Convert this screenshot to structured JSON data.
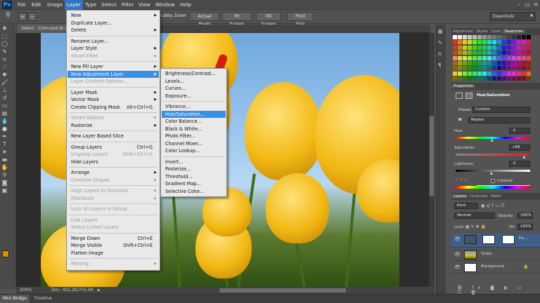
{
  "app": {
    "logo": "Ps"
  },
  "menubar": {
    "items": [
      "File",
      "Edit",
      "Image",
      "Layer",
      "Type",
      "Select",
      "Filter",
      "View",
      "Window",
      "Help"
    ],
    "active": "Layer"
  },
  "window_buttons": [
    "–",
    "▭",
    "✕"
  ],
  "options": {
    "buttons": [
      "rubby Zoom",
      "Actual Pixels",
      "Fit Screen",
      "Fill Screen",
      "Print Size"
    ],
    "workspace": "Essentials"
  },
  "document": {
    "tab": "Select - Color.psd @ 2",
    "zoom": "200%",
    "doc_info": "Doc: 452.2K/755.5K"
  },
  "bottom_tabs": [
    "Mini Bridge",
    "Timeline"
  ],
  "layer_menu": {
    "items": [
      {
        "label": "New",
        "arrow": true
      },
      {
        "label": "Duplicate Layer..."
      },
      {
        "label": "Delete",
        "arrow": true
      },
      {
        "sep": true
      },
      {
        "label": "Rename Layer..."
      },
      {
        "label": "Layer Style",
        "arrow": true
      },
      {
        "label": "Smart Filter",
        "arrow": true,
        "disabled": true
      },
      {
        "sep": true
      },
      {
        "label": "New Fill Layer",
        "arrow": true
      },
      {
        "label": "New Adjustment Layer",
        "arrow": true,
        "highlight": true
      },
      {
        "label": "Layer Content Options...",
        "disabled": true
      },
      {
        "sep": true
      },
      {
        "label": "Layer Mask",
        "arrow": true
      },
      {
        "label": "Vector Mask",
        "arrow": true
      },
      {
        "label": "Create Clipping Mask",
        "shortcut": "Alt+Ctrl+G"
      },
      {
        "sep": true
      },
      {
        "label": "Smart Objects",
        "arrow": true,
        "disabled": true
      },
      {
        "label": "Rasterize",
        "arrow": true
      },
      {
        "sep": true
      },
      {
        "label": "New Layer Based Slice"
      },
      {
        "sep": true
      },
      {
        "label": "Group Layers",
        "shortcut": "Ctrl+G"
      },
      {
        "label": "Ungroup Layers",
        "shortcut": "Shift+Ctrl+G",
        "disabled": true
      },
      {
        "label": "Hide Layers"
      },
      {
        "sep": true
      },
      {
        "label": "Arrange",
        "arrow": true
      },
      {
        "label": "Combine Shapes",
        "arrow": true,
        "disabled": true
      },
      {
        "sep": true
      },
      {
        "label": "Align Layers to Selection",
        "arrow": true,
        "disabled": true
      },
      {
        "label": "Distribute",
        "arrow": true,
        "disabled": true
      },
      {
        "sep": true
      },
      {
        "label": "Lock All Layers in Group...",
        "disabled": true
      },
      {
        "sep": true
      },
      {
        "label": "Link Layers",
        "disabled": true
      },
      {
        "label": "Select Linked Layers",
        "disabled": true
      },
      {
        "sep": true
      },
      {
        "label": "Merge Down",
        "shortcut": "Ctrl+E"
      },
      {
        "label": "Merge Visible",
        "shortcut": "Shift+Ctrl+E"
      },
      {
        "label": "Flatten Image"
      },
      {
        "sep": true
      },
      {
        "label": "Matting",
        "arrow": true,
        "disabled": true
      }
    ]
  },
  "adjustment_submenu": {
    "items": [
      {
        "label": "Brightness/Contrast..."
      },
      {
        "label": "Levels..."
      },
      {
        "label": "Curves..."
      },
      {
        "label": "Exposure..."
      },
      {
        "sep": true
      },
      {
        "label": "Vibrance..."
      },
      {
        "label": "Hue/Saturation...",
        "highlight": true
      },
      {
        "label": "Color Balance..."
      },
      {
        "label": "Black & White..."
      },
      {
        "label": "Photo Filter..."
      },
      {
        "label": "Channel Mixer..."
      },
      {
        "label": "Color Lookup..."
      },
      {
        "sep": true
      },
      {
        "label": "Invert..."
      },
      {
        "label": "Posterize..."
      },
      {
        "label": "Threshold..."
      },
      {
        "label": "Gradient Map..."
      },
      {
        "label": "Selective Color..."
      }
    ]
  },
  "swatch_tabs": [
    "Adjustmen",
    "Styles",
    "Color",
    "Swatches"
  ],
  "properties": {
    "header": "Properties",
    "title": "Hue/Saturation",
    "preset_label": "Preset:",
    "preset_value": "Custom",
    "channel": "Master",
    "hue_label": "Hue:",
    "hue": "-1",
    "saturation_label": "Saturation:",
    "saturation": "+86",
    "lightness_label": "Lightness:",
    "lightness": "-2",
    "colorize": "Colorize",
    "slider_values": {
      "hue": -1,
      "saturation": 86,
      "lightness": -2
    }
  },
  "layers_panel": {
    "tabs": [
      "Layers",
      "Channels",
      "Paths"
    ],
    "kind": "Kind",
    "blend": "Normal",
    "opacity_label": "Opacity:",
    "opacity": "100%",
    "lock_label": "Lock:",
    "fill_label": "Fill:",
    "fill": "100%",
    "layers": [
      {
        "name": "Hu...",
        "selected": true
      },
      {
        "name": "Tulips"
      },
      {
        "name": "Background"
      }
    ]
  },
  "colors": {
    "highlight": "#3b8fe0",
    "menu_active": "#3573c4",
    "fg_swatch": "#e58a00",
    "bg_swatch": "#ffffff"
  }
}
